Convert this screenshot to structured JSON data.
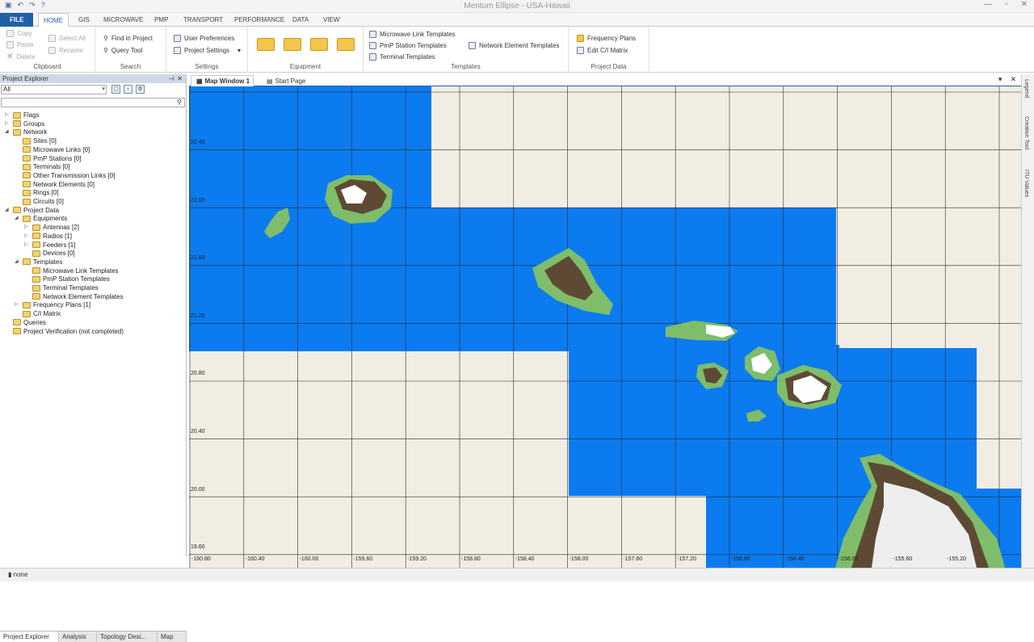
{
  "window": {
    "title": "Mentum Ellipse - USA-Hawaii"
  },
  "tabs": [
    "FILE",
    "HOME",
    "GIS",
    "MICROWAVE",
    "PMP",
    "TRANSPORT",
    "PERFORMANCE",
    "DATA",
    "VIEW"
  ],
  "ribbon": {
    "clipboard": {
      "label": "Clipboard",
      "copy": "Copy",
      "paste": "Paste",
      "delete": "Delete",
      "select_all": "Select All",
      "rename": "Rename"
    },
    "search": {
      "label": "Search",
      "find": "Find in Project",
      "query": "Query Tool"
    },
    "settings": {
      "label": "Settings",
      "user_prefs": "User Preferences",
      "project_settings": "Project Settings"
    },
    "equipment": {
      "label": "Equipment"
    },
    "templates": {
      "label": "Templates",
      "mw": "Microwave Link Templates",
      "pmp": "PmP Station Templates",
      "term": "Terminal Templates",
      "ne": "Network Element Templates"
    },
    "project_data": {
      "label": "Project Data",
      "freq": "Frequency Plans",
      "ci": "Edit C/I Matrix"
    }
  },
  "project_explorer": {
    "title": "Project Explorer",
    "filter": "All",
    "search_placeholder": "",
    "tree": [
      {
        "label": "Flags",
        "level": 0,
        "arrow": "▷"
      },
      {
        "label": "Groups",
        "level": 0,
        "arrow": "▷"
      },
      {
        "label": "Network",
        "level": 0,
        "arrow": "◢"
      },
      {
        "label": "Sites [0]",
        "level": 1,
        "arrow": ""
      },
      {
        "label": "Microwave Links [0]",
        "level": 1,
        "arrow": ""
      },
      {
        "label": "PmP Stations [0]",
        "level": 1,
        "arrow": ""
      },
      {
        "label": "Terminals [0]",
        "level": 1,
        "arrow": ""
      },
      {
        "label": "Other Transmission Links [0]",
        "level": 1,
        "arrow": ""
      },
      {
        "label": "Network Elements [0]",
        "level": 1,
        "arrow": ""
      },
      {
        "label": "Rings [0]",
        "level": 1,
        "arrow": ""
      },
      {
        "label": "Circuits [0]",
        "level": 1,
        "arrow": ""
      },
      {
        "label": "Project Data",
        "level": 0,
        "arrow": "◢"
      },
      {
        "label": "Equipments",
        "level": 1,
        "arrow": "◢"
      },
      {
        "label": "Antennas [2]",
        "level": 2,
        "arrow": "▷"
      },
      {
        "label": "Radios [1]",
        "level": 2,
        "arrow": "▷"
      },
      {
        "label": "Feeders [1]",
        "level": 2,
        "arrow": "▷"
      },
      {
        "label": "Devices [0]",
        "level": 2,
        "arrow": ""
      },
      {
        "label": "Templates",
        "level": 1,
        "arrow": "◢"
      },
      {
        "label": "Microwave Link Templates",
        "level": 2,
        "arrow": ""
      },
      {
        "label": "PmP Station Templates",
        "level": 2,
        "arrow": ""
      },
      {
        "label": "Terminal Templates",
        "level": 2,
        "arrow": ""
      },
      {
        "label": "Network Element Templates",
        "level": 2,
        "arrow": ""
      },
      {
        "label": "Frequency Plans [1]",
        "level": 1,
        "arrow": "▷"
      },
      {
        "label": "C/I Matrix",
        "level": 1,
        "arrow": ""
      },
      {
        "label": "Queries",
        "level": 0,
        "arrow": ""
      },
      {
        "label": "Project Verification (not completed)",
        "level": 0,
        "arrow": ""
      }
    ],
    "bottom_tabs": [
      "Project Explorer",
      "Analysis",
      "Topology Desi...",
      "Map"
    ]
  },
  "doc_tabs": [
    "Map Window 1",
    "Start Page"
  ],
  "map": {
    "lat_labels": [
      "22.40",
      "22.00",
      "21.60",
      "21.20",
      "20.80",
      "20.40",
      "20.00",
      "19.60"
    ],
    "lon_labels": [
      "-160.80",
      "-160.40",
      "-160.00",
      "-159.60",
      "-159.20",
      "-158.80",
      "-158.40",
      "-158.00",
      "-157.60",
      "-157.20",
      "-156.80",
      "-156.40",
      "-156.00",
      "-155.60",
      "-155.20"
    ],
    "colors": {
      "ocean": "#0c7bf0",
      "land": "#f2ede3",
      "island_green": "#7ebd6a",
      "island_brown": "#5e4a34"
    }
  },
  "right_panel": [
    "Legend",
    "Creation Tool",
    "ITU Values"
  ],
  "status": {
    "text": "none"
  }
}
